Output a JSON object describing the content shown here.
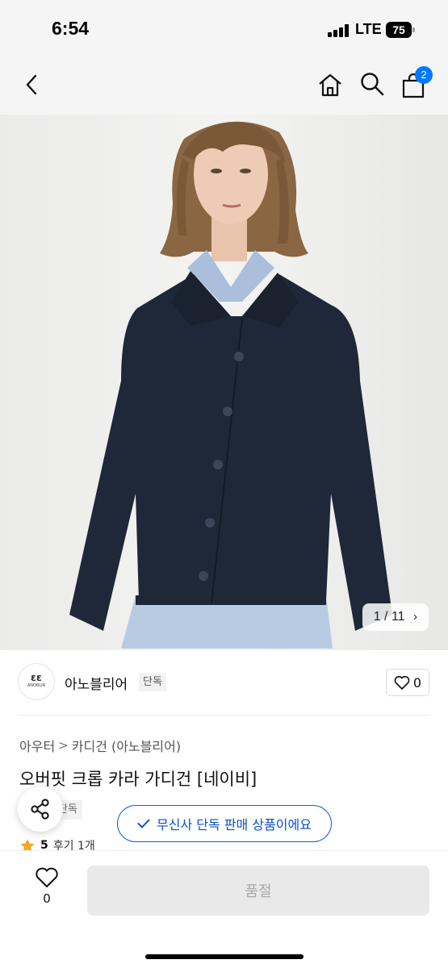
{
  "status_bar": {
    "time": "6:54",
    "network": "LTE",
    "battery": "75"
  },
  "header": {
    "back_icon": "chevron-left-icon",
    "home_icon": "home-icon",
    "search_icon": "search-icon",
    "cart_icon": "shopping-bag-icon",
    "cart_count": "2",
    "accent_color": "#0078ff"
  },
  "gallery": {
    "counter": "1 / 11",
    "counter_icon": "chevron-right-icon"
  },
  "brand": {
    "logo_mark": "ƐƐ",
    "logo_text": "ANOBLIR",
    "name": "아노블리어",
    "tag": "단독",
    "like_count": "0"
  },
  "breadcrumb": {
    "items": [
      "아우터",
      "카디건 (아노블리어)"
    ],
    "separator": ">"
  },
  "product": {
    "title": "오버핏 크롭 카라 가디건 [네이비]",
    "tag": "단독",
    "exclusive_notice": "무신사 단독 판매 상품이에요",
    "notice_color": "#0a4fc8"
  },
  "review": {
    "star_icon": "star-icon",
    "score": "5",
    "label": "후기 1개"
  },
  "bottom_bar": {
    "wish_count": "0",
    "soldout_label": "품절"
  }
}
